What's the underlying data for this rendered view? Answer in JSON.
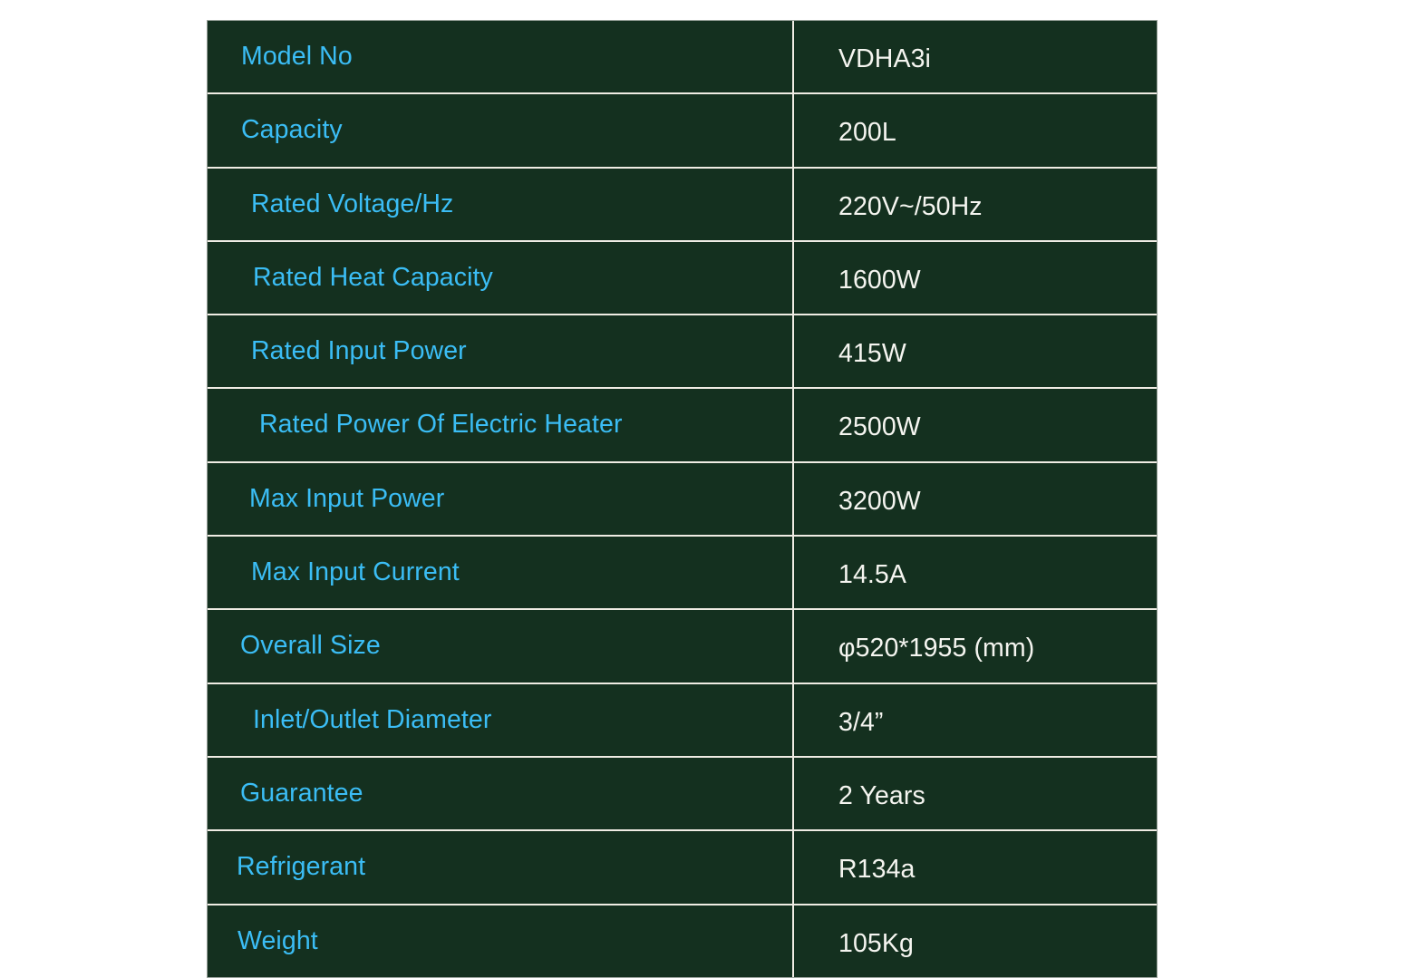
{
  "theme": {
    "page_background": "#ffffff",
    "cell_background": "#14301f",
    "grid_line_color": "#f0ece4",
    "outer_border_color": "#9aa39c",
    "label_color": "#3bbdf5",
    "value_color": "#f5f5f0"
  },
  "spec_table": {
    "rows": [
      {
        "label": "Model No",
        "value": "VDHA3i",
        "indent": 37
      },
      {
        "label": "Capacity",
        "value": "200L",
        "indent": 37
      },
      {
        "label": "Rated Voltage/Hz",
        "value": "220V~/50Hz",
        "indent": 48
      },
      {
        "label": "Rated Heat Capacity",
        "value": "1600W",
        "indent": 50
      },
      {
        "label": "Rated Input Power",
        "value": "415W",
        "indent": 48
      },
      {
        "label": "Rated Power Of Electric Heater",
        "value": "2500W",
        "indent": 57
      },
      {
        "label": "Max Input Power",
        "value": "3200W",
        "indent": 46
      },
      {
        "label": "Max Input Current",
        "value": "14.5A",
        "indent": 48
      },
      {
        "label": "Overall Size",
        "value": "φ520*1955 (mm)",
        "indent": 36
      },
      {
        "label": "Inlet/Outlet Diameter",
        "value": "3/4”",
        "indent": 50
      },
      {
        "label": "Guarantee",
        "value": "2 Years",
        "indent": 36
      },
      {
        "label": "Refrigerant",
        "value": "R134a",
        "indent": 32
      },
      {
        "label": "Weight",
        "value": "105Kg",
        "indent": 33
      }
    ]
  }
}
